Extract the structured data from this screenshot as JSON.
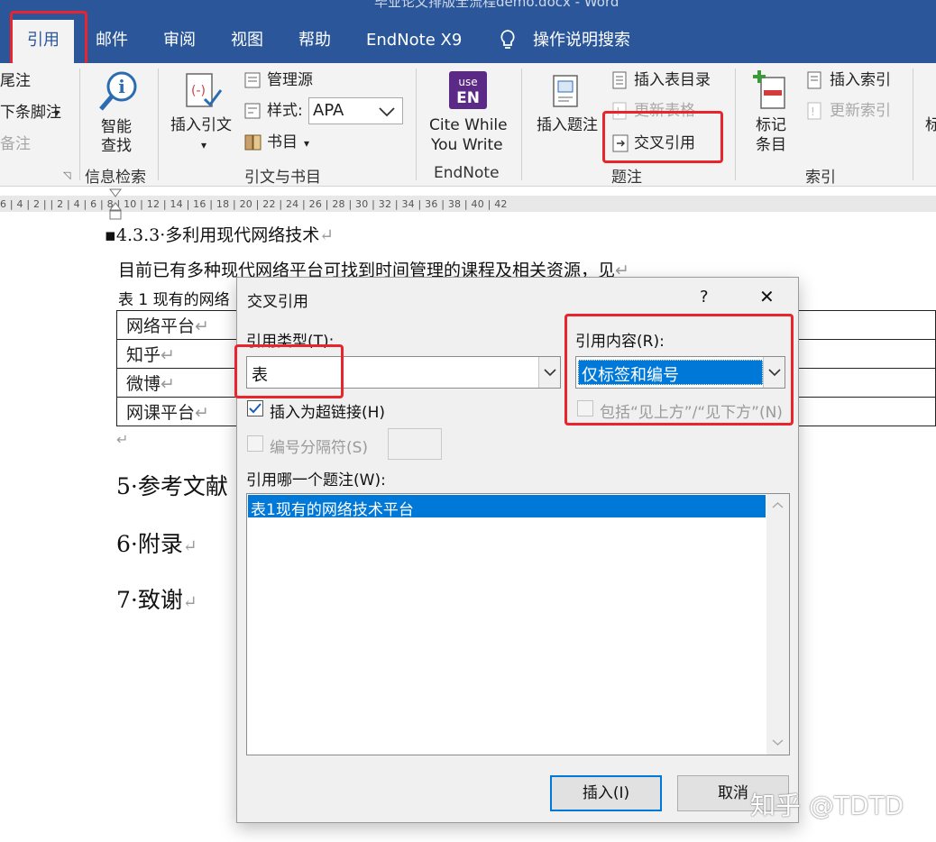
{
  "titlebar": {
    "title": "毕业论文排版全流程demo.docx - Word"
  },
  "tabs": [
    {
      "label": "引用"
    },
    {
      "label": "邮件"
    },
    {
      "label": "审阅"
    },
    {
      "label": "视图"
    },
    {
      "label": "帮助"
    },
    {
      "label": "EndNote X9"
    },
    {
      "label": "操作说明搜索"
    }
  ],
  "ribbon": {
    "footnotes": {
      "items": [
        "尾注",
        "下条脚注",
        "备注"
      ]
    },
    "research": {
      "button": [
        "智能",
        "查找"
      ],
      "group": "信息检索"
    },
    "citations": {
      "insert": "插入引文",
      "manage": "管理源",
      "style_label": "样式:",
      "style_value": "APA",
      "bibliography": "书目",
      "group": "引文与书目"
    },
    "endnote": {
      "badge_top": "use",
      "badge_bottom": "EN",
      "button": [
        "Cite While",
        "You Write"
      ],
      "group": "EndNote"
    },
    "captions": {
      "insert": "插入题注",
      "table_of_figures": "插入表目录",
      "update": "更新表格",
      "cross_reference": "交叉引用",
      "group": "题注"
    },
    "index": {
      "mark": [
        "标记",
        "条目"
      ],
      "insert": "插入索引",
      "update": "更新索引",
      "group": "索引"
    },
    "overflow": "标"
  },
  "ruler": {
    "scale": "6 | 4 | 2 |       | 2 | 4 | 6 | 8 | 10 | 12 | 14 | 16 | 18 | 20 | 22 | 24 | 26 | 28 | 30 | 32 | 34 | 36 | 38 | 40 | 42"
  },
  "document": {
    "heading_433": "4.3.3·多利用现代网络技术",
    "para": "目前已有多种现代网络平台可找到时间管理的课程及相关资源，见",
    "table_caption": "表 1 现有的网络",
    "table_rows": [
      "网络平台",
      "知乎",
      "微博",
      "网课平台"
    ],
    "heading_5": "5·参考文献",
    "heading_6": "6·附录",
    "heading_7": "7·致谢",
    "paragraph_mark": "↵"
  },
  "dialog": {
    "title": "交叉引用",
    "help": "?",
    "close": "✕",
    "ref_type_label": "引用类型(T):",
    "ref_type_value": "表",
    "ref_content_label": "引用内容(R):",
    "ref_content_value": "仅标签和编号",
    "hyperlink_label": "插入为超链接(H)",
    "hyperlink_checked": true,
    "above_below_label": "包括“见上方”/“见下方”(N)",
    "separator_label": "编号分隔符(S)",
    "which_caption_label": "引用哪一个题注(W):",
    "caption_items": [
      "表1现有的网络技术平台"
    ],
    "insert_button": "插入(I)",
    "cancel_button": "取消"
  },
  "watermark": "知乎 @TDTD",
  "colors": {
    "word_blue": "#2b579a",
    "highlight": "#0078d7",
    "annotation_red": "#e8242c"
  }
}
